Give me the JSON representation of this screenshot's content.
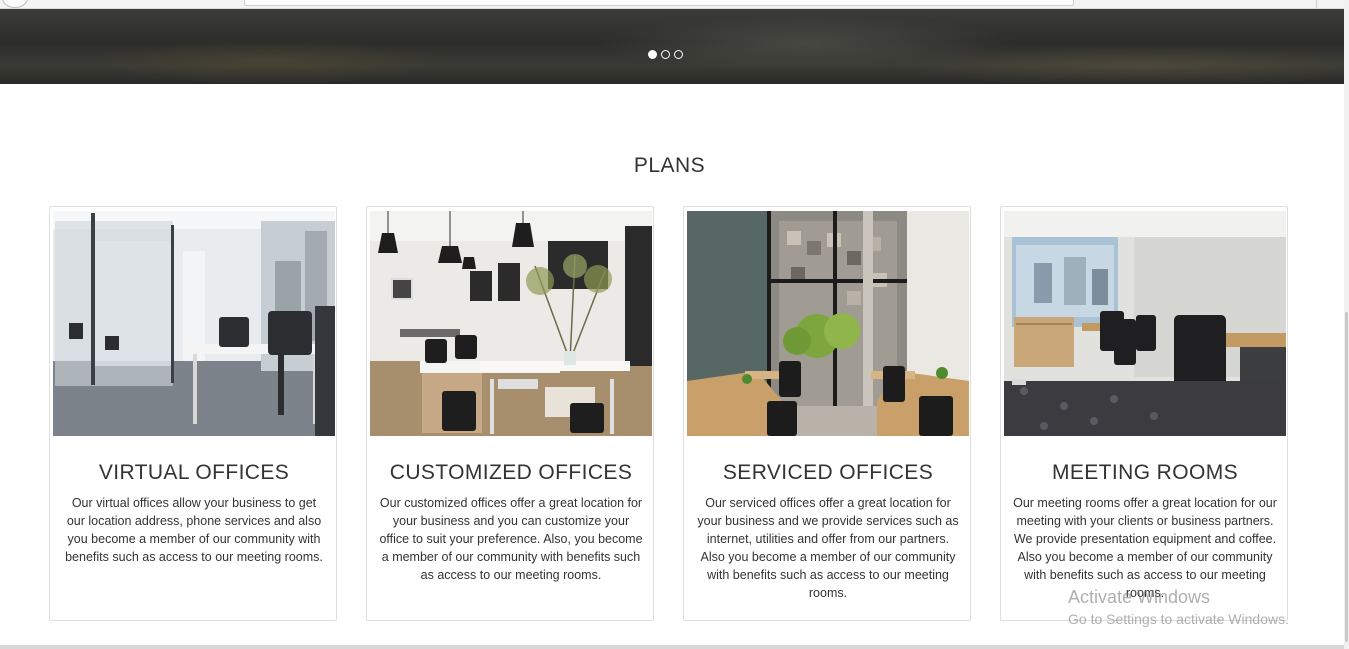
{
  "slider": {
    "dots": [
      {
        "label": "slide-1",
        "active": true
      },
      {
        "label": "slide-2",
        "active": false
      },
      {
        "label": "slide-3",
        "active": false
      }
    ]
  },
  "plans": {
    "title": "PLANS",
    "cards": [
      {
        "title": "VIRTUAL OFFICES",
        "image": "office-with-glass-walls-photo",
        "text": "Our virtual offices allow your business to get our location address, phone services and also you become a member of our community with benefits such as access to our meeting rooms."
      },
      {
        "title": "CUSTOMIZED OFFICES",
        "image": "open-plan-office-with-pendant-lights-photo",
        "text": "Our customized offices offer a great location for your business and you can customize your office to suit your preference. Also, you become a member of our community with benefits such as access to our meeting rooms."
      },
      {
        "title": "SERVICED OFFICES",
        "image": "office-with-courtyard-window-photo",
        "text": "Our serviced offices offer a great location for your business and we provide services such as internet, utilities and offer from our partners. Also you become a member of our community with benefits such as access to our meeting rooms."
      },
      {
        "title": "MEETING ROOMS",
        "image": "meeting-room-photo",
        "text": "Our meeting rooms offer a great location for our meeting with your clients or business partners. We provide presentation equipment and coffee. Also you become a member of our community with benefits such as access to our meeting rooms."
      }
    ]
  },
  "watermark": {
    "title": "Activate Windows",
    "subtitle": "Go to Settings to activate Windows."
  }
}
